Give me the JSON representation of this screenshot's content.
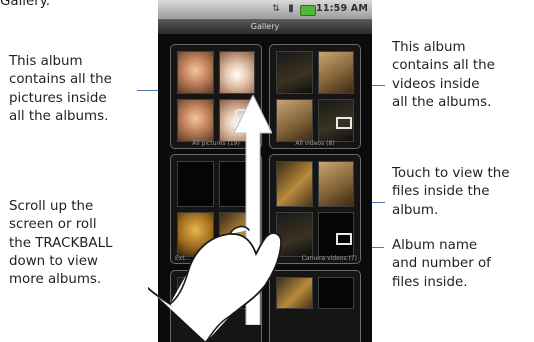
{
  "top_caption": "Gallery.",
  "annotations": {
    "all_pictures_album": [
      "This album",
      "contains all the",
      "pictures inside",
      "all the albums."
    ],
    "scroll_hint": [
      "Scroll up the",
      "screen or roll",
      "the TRACKBALL",
      "down to view",
      "more albums."
    ],
    "all_videos_album": [
      "This album",
      "contains all the",
      "videos inside",
      "all the albums."
    ],
    "touch_hint": [
      "Touch to view the",
      "files inside the",
      "album."
    ],
    "album_name_hint": [
      "Album name",
      "and number of",
      "files inside."
    ]
  },
  "phone": {
    "status_time": "11:59 AM",
    "title": "Gallery",
    "albums": [
      {
        "label": "All pictures (19)"
      },
      {
        "label": "All videos (8)"
      },
      {
        "label": "Ext..."
      },
      {
        "label": "Camera videos (7)"
      }
    ]
  },
  "colors": {
    "callout_line": "#4a76a8",
    "screen_bg": "#0b0b0b",
    "battery": "#4fb83a"
  },
  "icons": [
    "sync-icon",
    "signal-icon",
    "battery-icon",
    "camera-icon",
    "film-icon",
    "up-arrow",
    "pointing-hand"
  ]
}
